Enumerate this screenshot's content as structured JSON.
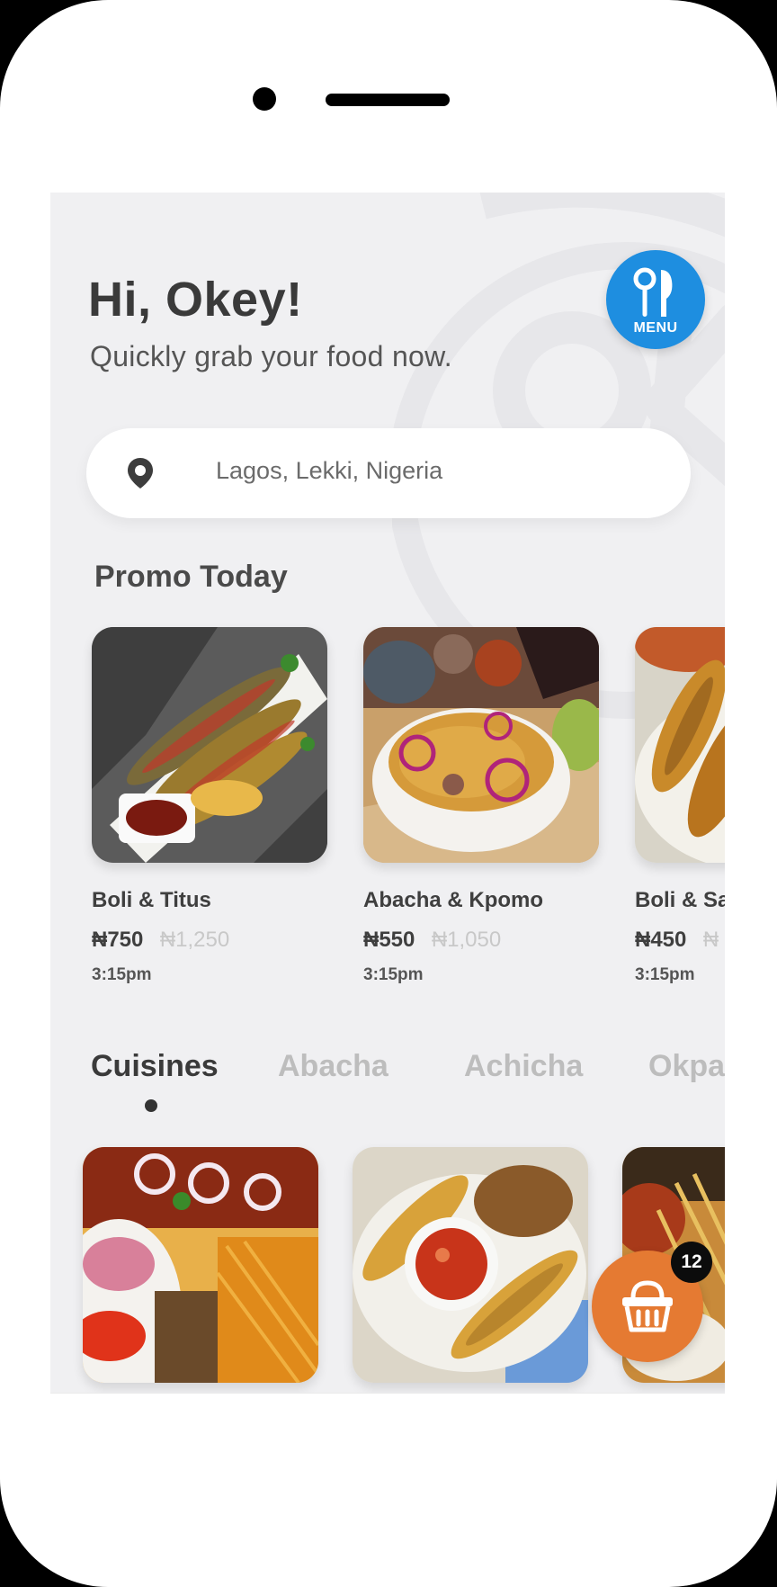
{
  "header": {
    "greeting": "Hi, Okey!",
    "subtitle": "Quickly grab your food now.",
    "menu_label": "MENU"
  },
  "search": {
    "location": "Lagos, Lekki, Nigeria",
    "icon": "location-pin-icon"
  },
  "promo": {
    "title": "Promo Today",
    "items": [
      {
        "name": "Boli & Titus",
        "price": "₦750",
        "old_price": "₦1,250",
        "time": "3:15pm"
      },
      {
        "name": "Abacha & Kpomo",
        "price": "₦550",
        "old_price": "₦1,050",
        "time": "3:15pm"
      },
      {
        "name": "Boli & Sa",
        "price": "₦450",
        "old_price": "₦",
        "time": "3:15pm"
      }
    ]
  },
  "tabs": [
    "Cuisines",
    "Abacha",
    "Achicha",
    "Okpa"
  ],
  "active_tab": "Cuisines",
  "cart": {
    "count": "12",
    "icon": "basket-icon"
  },
  "colors": {
    "accent_blue": "#1e8ee0",
    "cart_orange": "#e57a32",
    "screen_bg": "#f0f0f2"
  }
}
